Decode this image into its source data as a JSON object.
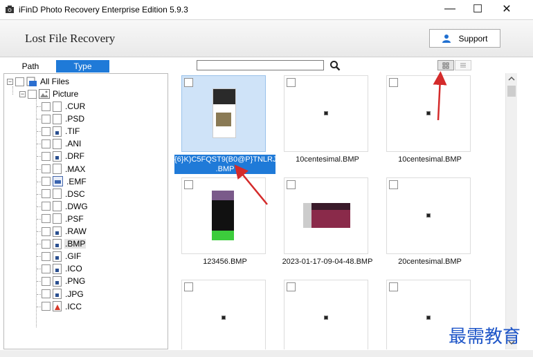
{
  "window": {
    "title": "iFinD Photo Recovery Enterprise Edition 5.9.3",
    "controls": {
      "minimize": "—",
      "maximize": "☐",
      "close": "✕"
    }
  },
  "header": {
    "title": "Lost File Recovery",
    "support_label": "Support"
  },
  "tabs": [
    {
      "label": "Path",
      "active": false
    },
    {
      "label": "Type",
      "active": true
    }
  ],
  "search": {
    "value": "",
    "placeholder": ""
  },
  "view_modes": [
    {
      "name": "grid",
      "selected": true
    },
    {
      "name": "list",
      "selected": false
    }
  ],
  "tree": {
    "root": "All Files",
    "group": "Picture",
    "items": [
      ".CUR",
      ".PSD",
      ".TIF",
      ".ANI",
      ".DRF",
      ".MAX",
      ".EMF",
      ".DSC",
      ".DWG",
      ".PSF",
      ".RAW",
      ".BMP",
      ".GIF",
      ".ICO",
      ".PNG",
      ".JPG",
      ".ICC"
    ],
    "selected": ".BMP"
  },
  "files": [
    {
      "name": "{6}K)C5FQST9(B0@P}TNLRJ.BMP",
      "caption_lines": [
        "{6}K)C5FQST9(B0@P}TNLRJ",
        ".BMP"
      ],
      "selected": true
    },
    {
      "name": "10centesimal.BMP",
      "caption_lines": [
        "10centesimal.BMP"
      ],
      "selected": false
    },
    {
      "name": "10centesimal.BMP",
      "caption_lines": [
        "10centesimal.BMP"
      ],
      "selected": false
    },
    {
      "name": "123456.BMP",
      "caption_lines": [
        "123456.BMP"
      ],
      "selected": false
    },
    {
      "name": "2023-01-17-09-04-48.BMP",
      "caption_lines": [
        "2023-01-17-09-04-48.BMP"
      ],
      "selected": false
    },
    {
      "name": "20centesimal.BMP",
      "caption_lines": [
        "20centesimal.BMP"
      ],
      "selected": false
    },
    {
      "name": "",
      "caption_lines": [],
      "selected": false
    },
    {
      "name": "",
      "caption_lines": [],
      "selected": false
    },
    {
      "name": "",
      "caption_lines": [],
      "selected": false
    }
  ],
  "watermark": "最需教育",
  "colors": {
    "accent": "#1f7ad8",
    "annotation_arrow": "#d42b2b"
  }
}
